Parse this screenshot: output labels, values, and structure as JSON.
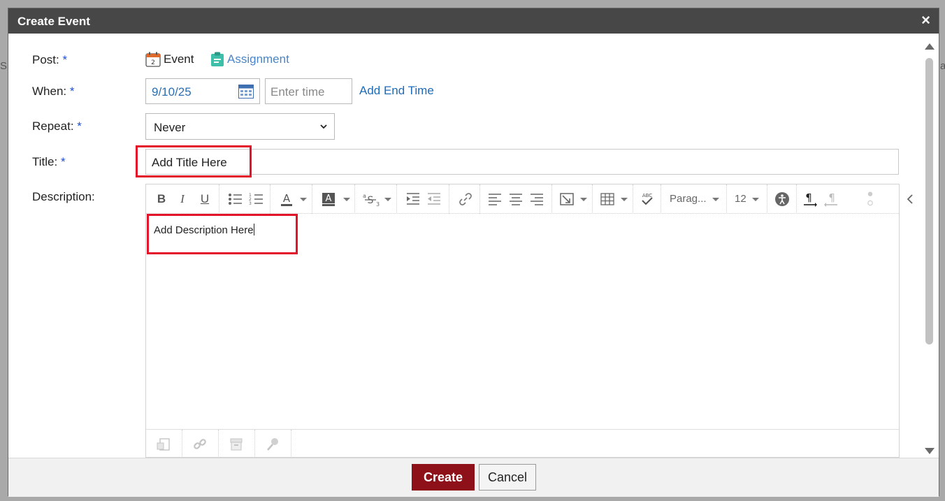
{
  "background": {
    "left_fragment": "Su",
    "right_fragment": "a"
  },
  "dialog": {
    "title": "Create Event",
    "close_glyph": "×"
  },
  "form": {
    "post": {
      "label": "Post:",
      "required": "*",
      "options": {
        "event": "Event",
        "assignment": "Assignment"
      }
    },
    "when": {
      "label": "When:",
      "required": "*",
      "date_value": "9/10/25",
      "time_placeholder": "Enter time",
      "end_time_link": "Add End Time"
    },
    "repeat": {
      "label": "Repeat:",
      "required": "*",
      "selected": "Never"
    },
    "title": {
      "label": "Title:",
      "required": "*",
      "value": "Add Title Here"
    },
    "description": {
      "label": "Description:",
      "value": "Add Description Here"
    }
  },
  "toolbar": {
    "bold": "B",
    "italic": "I",
    "underline": "U",
    "paragraph": "Parag...",
    "font_size": "12",
    "spell_label": "ABC"
  },
  "footer": {
    "create": "Create",
    "cancel": "Cancel"
  },
  "colors": {
    "titlebar": "#474747",
    "create_button": "#8e1119",
    "highlight_box": "#e3142a",
    "link": "#1e6bb8",
    "required": "#1f4fd0"
  }
}
